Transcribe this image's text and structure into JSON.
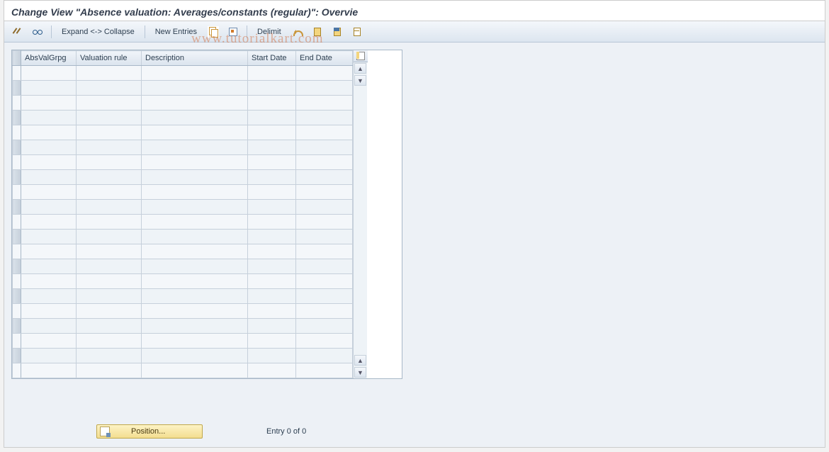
{
  "title": "Change View \"Absence valuation: Averages/constants (regular)\": Overvie",
  "toolbar": {
    "expand_collapse": "Expand <-> Collapse",
    "new_entries": "New Entries",
    "delimit": "Delimit"
  },
  "table": {
    "columns": {
      "absvalgrpg": "AbsValGrpg",
      "valuation_rule": "Valuation rule",
      "description": "Description",
      "start_date": "Start Date",
      "end_date": "End Date"
    },
    "row_count": 21
  },
  "footer": {
    "position_label": "Position...",
    "entry_text": "Entry 0 of 0"
  },
  "watermark": "www.tutorialkart.com"
}
